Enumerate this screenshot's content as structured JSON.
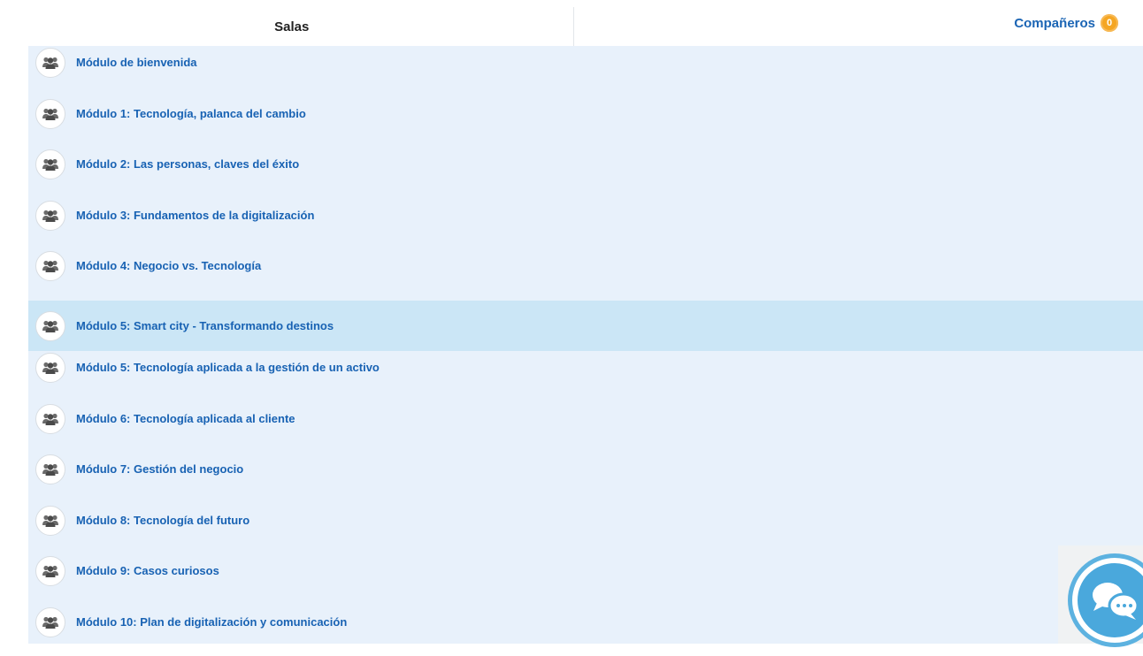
{
  "tabs": {
    "salas": "Salas",
    "companeros": "Compañeros",
    "companeros_count": "0"
  },
  "rooms": [
    {
      "label": "Módulo de bienvenida",
      "active": false
    },
    {
      "label": "Módulo 1: Tecnología, palanca del cambio",
      "active": false
    },
    {
      "label": "Módulo 2: Las personas, claves del éxito",
      "active": false
    },
    {
      "label": "Módulo 3: Fundamentos de la digitalización",
      "active": false
    },
    {
      "label": "Módulo 4: Negocio vs. Tecnología",
      "active": false
    },
    {
      "label": "Módulo 5: Smart city - Transformando destinos",
      "active": true
    },
    {
      "label": "Módulo 5: Tecnología aplicada a la gestión de un activo",
      "active": false
    },
    {
      "label": "Módulo 6: Tecnología aplicada al cliente",
      "active": false
    },
    {
      "label": "Módulo 7: Gestión del negocio",
      "active": false
    },
    {
      "label": "Módulo 8: Tecnología del futuro",
      "active": false
    },
    {
      "label": "Módulo 9: Casos curiosos",
      "active": false
    },
    {
      "label": "Módulo 10: Plan de digitalización y comunicación",
      "active": false
    }
  ],
  "icons": {
    "room": "group-icon",
    "chat": "chat-bubbles-icon"
  },
  "colors": {
    "link": "#1862b3",
    "list_bg": "#e8f1fb",
    "active_row": "#cbe6f6",
    "badge": "#f5a623",
    "chat": "#4aa8dc"
  }
}
